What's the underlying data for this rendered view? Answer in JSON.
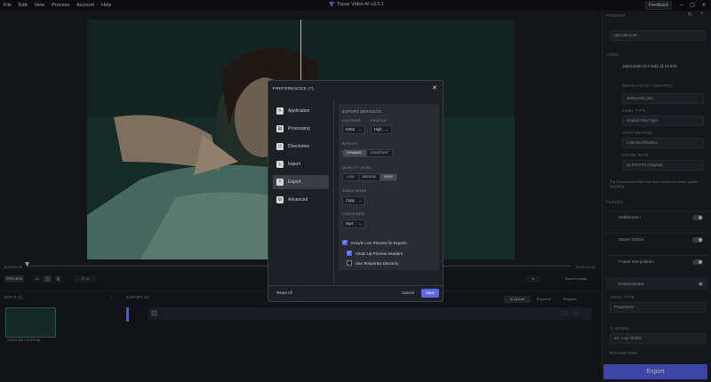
{
  "menubar": {
    "items": [
      "File",
      "Edit",
      "View",
      "Process",
      "Account",
      "Help"
    ],
    "app_title": "Topaz Video AI  v3.5.1",
    "feedback": "Feedback"
  },
  "timeline": {
    "left_time": "00:00:00.00",
    "right_time": "00:00:15.03"
  },
  "bottombar": {
    "preview": "PREVIEW",
    "speed": "1x",
    "zoom": "Zoom to input"
  },
  "inputpanel": {
    "title": "INPUT (1)",
    "thumb_caption": "1920x1080 / 23.976 fps",
    "export_title": "EXPORT (1)",
    "tabs": [
      "In Queue",
      "Exported",
      "Stopped"
    ]
  },
  "right": {
    "presets_label": "PRESETS",
    "preset_value": "Upscale to 4K",
    "video_label": "VIDEO",
    "video_info": "1920x1040 (4:3 Sub) @ 23.976",
    "output_res_label": "RESOLUTION / CONTROL",
    "output_res_value": "3840x2160 (4K)",
    "pixel_label": "PIXEL TYPE",
    "pixel_value": "Original Pixel Type",
    "crop_label": "CROP METHOD",
    "crop_value": "Letterbox/Pillarbox",
    "fps_label": "FRAME RATE",
    "fps_value": "23.976 FPS (Original)",
    "note": "The Enhancement filter has been enabled for better quality upscaling.",
    "filters_label": "FILTERS",
    "filters": [
      "Stabilization",
      "Motion Deblur",
      "Frame Interpolation"
    ],
    "enhancement": "Enhancement",
    "video_type_label": "VIDEO TYPE",
    "video_type_value": "Progressive",
    "ai_model_label": "AI MODEL",
    "ai_model_value": "Iris - LQ / Deblur",
    "parameters_label": "PARAMETERS",
    "export_button": "Export"
  },
  "modal": {
    "title": "PREFERENCES  (?)",
    "nav": [
      "Application",
      "Processing",
      "Directories",
      "Import",
      "Export",
      "Advanced"
    ],
    "active_nav": "Export",
    "section_title": "EXPORT DEFAULTS",
    "encoder_label": "ENCODER",
    "encoder_value": "H264",
    "profile_label": "PROFILE",
    "profile_value": "High",
    "bitrate_label": "BITRATE",
    "bitrate_options": [
      "DYNAMIC",
      "CONSTANT"
    ],
    "bitrate_selected": "DYNAMIC",
    "quality_label": "QUALITY LEVEL",
    "quality_options": [
      "LOW",
      "MEDIUM",
      "HIGH"
    ],
    "quality_selected": "HIGH",
    "audio_label": "AUDIO MODE",
    "audio_value": "Copy",
    "container_label": "CONTAINER",
    "container_value": "mp4",
    "checkboxes": [
      {
        "label": "Include Live Preview for Exports",
        "checked": true
      },
      {
        "label": "Clean Up Preview Headers",
        "checked": true
      },
      {
        "label": "Use Temporary Directory",
        "checked": false
      }
    ],
    "reset_all": "Reset All",
    "cancel": "Cancel",
    "save": "Save",
    "colors": {
      "accent": "#5b68e6",
      "save": "#5b68e6"
    }
  }
}
